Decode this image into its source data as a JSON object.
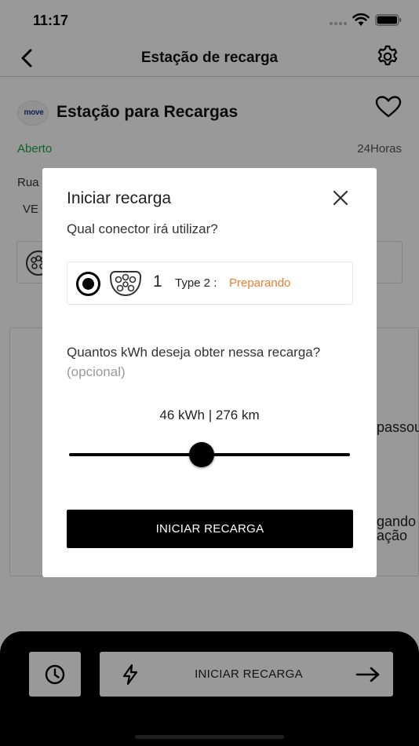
{
  "status_bar": {
    "time": "11:17"
  },
  "header": {
    "title": "Estação de recarga"
  },
  "station": {
    "logo_text": "move",
    "name": "Estação para Recargas",
    "open_status": "Aberto",
    "hours": "24Horas",
    "street_partial": "Rua",
    "ve_partial": "VE"
  },
  "background_partial_text": {
    "line1": "passou",
    "line2": "gando",
    "line3": "ação"
  },
  "modal": {
    "title": "Iniciar recarga",
    "connector_question": "Qual conector irá utilizar?",
    "connector": {
      "number": "1",
      "type": "Type 2 :",
      "status": "Preparando"
    },
    "kwh_question": "Quantos kWh deseja obter nessa recarga?",
    "optional_label": "(opcional)",
    "slider_readout": "46 kWh | 276 km",
    "slider_fraction": 0.45,
    "start_button": "INICIAR RECARGA"
  },
  "bottom_bar": {
    "start_label": "INICIAR RECARGA"
  },
  "colors": {
    "open": "#1ea34a",
    "status_preparing": "#f07e2e",
    "primary": "#000000"
  }
}
